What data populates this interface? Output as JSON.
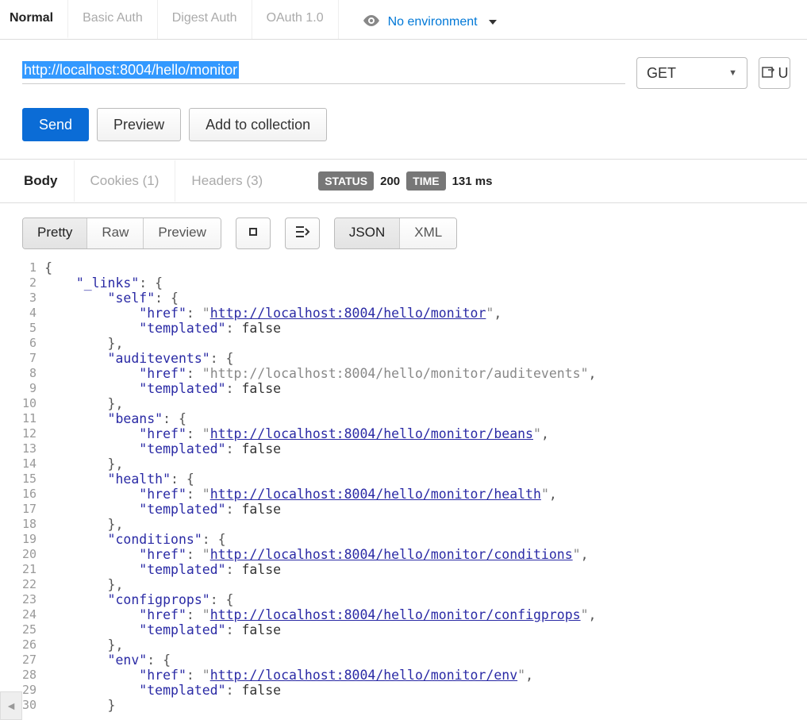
{
  "auth_tabs": {
    "normal": "Normal",
    "basic": "Basic Auth",
    "digest": "Digest Auth",
    "oauth": "OAuth 1.0"
  },
  "environment": {
    "label": "No environment"
  },
  "request": {
    "url": "http://localhost:8004/hello/monitor",
    "method": "GET",
    "url_param_button": "U"
  },
  "actions": {
    "send": "Send",
    "preview": "Preview",
    "add_collection": "Add to collection"
  },
  "response_tabs": {
    "body": "Body",
    "cookies": "Cookies (1)",
    "headers": "Headers (3)"
  },
  "status": {
    "status_label": "STATUS",
    "status_code": "200",
    "time_label": "TIME",
    "time_value": "131 ms"
  },
  "viewer": {
    "pretty": "Pretty",
    "raw": "Raw",
    "preview": "Preview",
    "json": "JSON",
    "xml": "XML"
  },
  "code": {
    "lines": [
      "{",
      "    \"_links\": {",
      "        \"self\": {",
      "            \"href\": \"http://localhost:8004/hello/monitor\",",
      "            \"templated\": false",
      "        },",
      "        \"auditevents\": {",
      "            \"href\": \"http://localhost:8004/hello/monitor/auditevents\",",
      "            \"templated\": false",
      "        },",
      "        \"beans\": {",
      "            \"href\": \"http://localhost:8004/hello/monitor/beans\",",
      "            \"templated\": false",
      "        },",
      "        \"health\": {",
      "            \"href\": \"http://localhost:8004/hello/monitor/health\",",
      "            \"templated\": false",
      "        },",
      "        \"conditions\": {",
      "            \"href\": \"http://localhost:8004/hello/monitor/conditions\",",
      "            \"templated\": false",
      "        },",
      "        \"configprops\": {",
      "            \"href\": \"http://localhost:8004/hello/monitor/configprops\",",
      "            \"templated\": false",
      "        },",
      "        \"env\": {",
      "            \"href\": \"http://localhost:8004/hello/monitor/env\",",
      "            \"templated\": false",
      "        }"
    ],
    "line_styles": [
      {
        "plain": "{"
      },
      {
        "indent": 4,
        "key": "_links",
        "tail": ": {"
      },
      {
        "indent": 8,
        "key": "self",
        "tail": ": {"
      },
      {
        "indent": 12,
        "key": "href",
        "url": "http://localhost:8004/hello/monitor",
        "linked": true
      },
      {
        "indent": 12,
        "key": "templated",
        "bool": "false"
      },
      {
        "indent": 8,
        "close": "},"
      },
      {
        "indent": 8,
        "key": "auditevents",
        "tail": ": {"
      },
      {
        "indent": 12,
        "key": "href",
        "url": "http://localhost:8004/hello/monitor/auditevents",
        "linked": false
      },
      {
        "indent": 12,
        "key": "templated",
        "bool": "false"
      },
      {
        "indent": 8,
        "close": "},"
      },
      {
        "indent": 8,
        "key": "beans",
        "tail": ": {"
      },
      {
        "indent": 12,
        "key": "href",
        "url": "http://localhost:8004/hello/monitor/beans",
        "linked": true
      },
      {
        "indent": 12,
        "key": "templated",
        "bool": "false"
      },
      {
        "indent": 8,
        "close": "},"
      },
      {
        "indent": 8,
        "key": "health",
        "tail": ": {"
      },
      {
        "indent": 12,
        "key": "href",
        "url": "http://localhost:8004/hello/monitor/health",
        "linked": true
      },
      {
        "indent": 12,
        "key": "templated",
        "bool": "false"
      },
      {
        "indent": 8,
        "close": "},"
      },
      {
        "indent": 8,
        "key": "conditions",
        "tail": ": {"
      },
      {
        "indent": 12,
        "key": "href",
        "url": "http://localhost:8004/hello/monitor/conditions",
        "linked": true
      },
      {
        "indent": 12,
        "key": "templated",
        "bool": "false"
      },
      {
        "indent": 8,
        "close": "},"
      },
      {
        "indent": 8,
        "key": "configprops",
        "tail": ": {"
      },
      {
        "indent": 12,
        "key": "href",
        "url": "http://localhost:8004/hello/monitor/configprops",
        "linked": true
      },
      {
        "indent": 12,
        "key": "templated",
        "bool": "false"
      },
      {
        "indent": 8,
        "close": "},"
      },
      {
        "indent": 8,
        "key": "env",
        "tail": ": {"
      },
      {
        "indent": 12,
        "key": "href",
        "url": "http://localhost:8004/hello/monitor/env",
        "linked": true
      },
      {
        "indent": 12,
        "key": "templated",
        "bool": "false"
      },
      {
        "indent": 8,
        "close": "}"
      }
    ]
  }
}
